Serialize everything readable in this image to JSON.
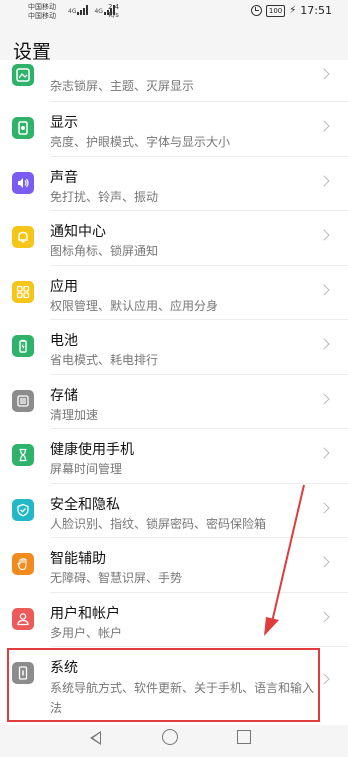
{
  "status_bar": {
    "carrier1": "中国移动",
    "carrier2": "中国移动",
    "signal1_label": "4G",
    "signal2_label": "4G",
    "speed_value": "2.4",
    "speed_unit": "K/s",
    "battery": "100",
    "time": "17:51"
  },
  "header": {
    "title": "设置"
  },
  "items": [
    {
      "title": "",
      "sub": "杂志锁屏、主题、灭屏显示",
      "color": "#2fb36b"
    },
    {
      "title": "显示",
      "sub": "亮度、护眼模式、字体与显示大小",
      "color": "#2fb36b"
    },
    {
      "title": "声音",
      "sub": "免打扰、铃声、振动",
      "color": "#7a5cf0"
    },
    {
      "title": "通知中心",
      "sub": "图标角标、锁屏通知",
      "color": "#f5c518"
    },
    {
      "title": "应用",
      "sub": "权限管理、默认应用、应用分身",
      "color": "#f5c518"
    },
    {
      "title": "电池",
      "sub": "省电模式、耗电排行",
      "color": "#2fb36b"
    },
    {
      "title": "存储",
      "sub": "清理加速",
      "color": "#8c8c8c"
    },
    {
      "title": "健康使用手机",
      "sub": "屏幕时间管理",
      "color": "#2fb36b"
    },
    {
      "title": "安全和隐私",
      "sub": "人脸识别、指纹、锁屏密码、密码保险箱",
      "color": "#22b8c8"
    },
    {
      "title": "智能辅助",
      "sub": "无障碍、智慧识屏、手势",
      "color": "#f28b1e"
    },
    {
      "title": "用户和帐户",
      "sub": "多用户、帐户",
      "color": "#ee5a5a"
    },
    {
      "title": "系统",
      "sub": "系统导航方式、软件更新、关于手机、语言和输入法",
      "color": "#8c8c8c"
    }
  ],
  "icons": [
    "wallpaper-icon",
    "display-icon",
    "sound-icon",
    "bell-icon",
    "apps-icon",
    "battery-icon",
    "storage-icon",
    "hourglass-icon",
    "shield-icon",
    "hand-icon",
    "user-icon",
    "phone-icon"
  ],
  "accent_colors": {
    "highlight": "#e23b3b"
  }
}
